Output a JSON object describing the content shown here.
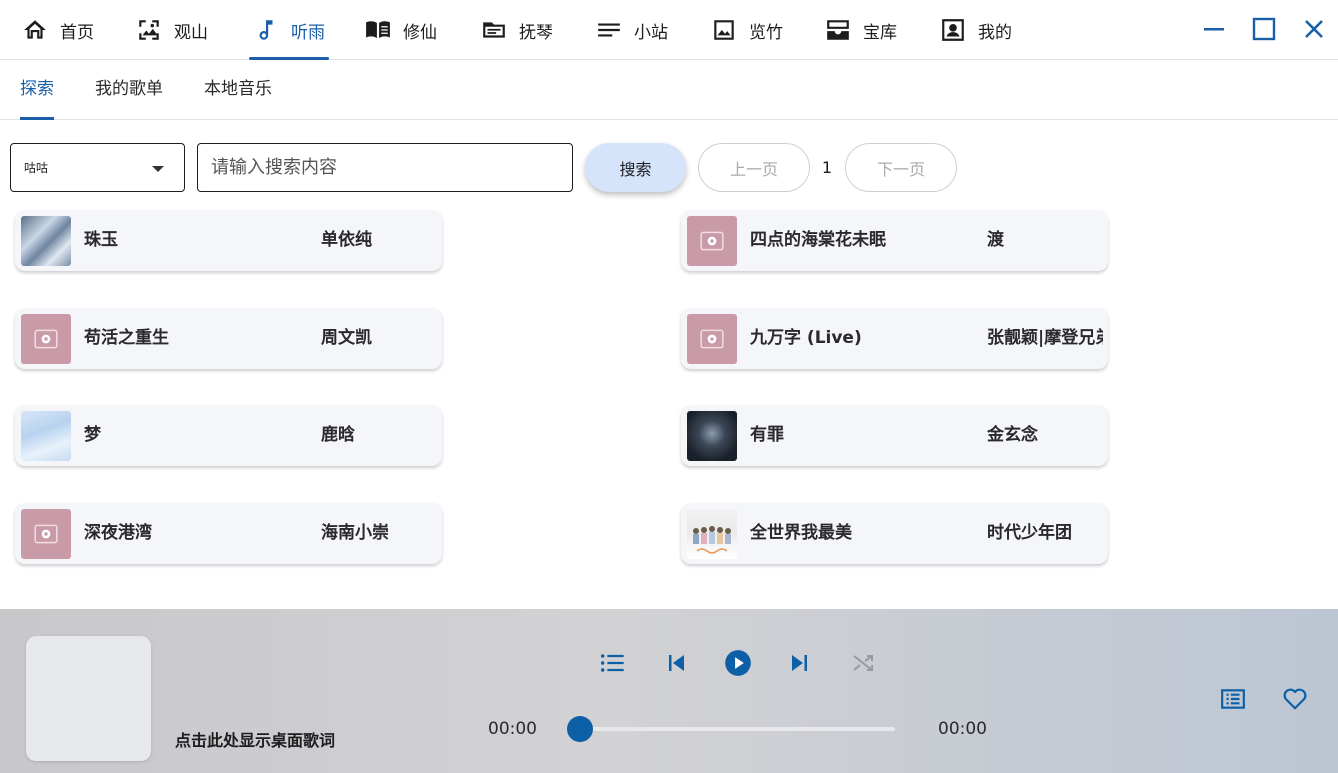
{
  "nav": {
    "items": [
      {
        "label": "首页",
        "icon": "home-icon"
      },
      {
        "label": "观山",
        "icon": "image-frame-icon"
      },
      {
        "label": "听雨",
        "icon": "music-note-icon"
      },
      {
        "label": "修仙",
        "icon": "book-open-icon"
      },
      {
        "label": "抚琴",
        "icon": "folder-icon"
      },
      {
        "label": "小站",
        "icon": "lines-icon"
      },
      {
        "label": "览竹",
        "icon": "photo-icon"
      },
      {
        "label": "宝库",
        "icon": "inbox-tray-icon"
      },
      {
        "label": "我的",
        "icon": "account-box-icon"
      }
    ],
    "active_index": 2
  },
  "subtabs": {
    "items": [
      {
        "label": "探索"
      },
      {
        "label": "我的歌单"
      },
      {
        "label": "本地音乐"
      }
    ],
    "active_index": 0
  },
  "search": {
    "source_value": "咕咕",
    "placeholder": "请输入搜索内容",
    "search_label": "搜索",
    "prev_label": "上一页",
    "page_number": "1",
    "next_label": "下一页"
  },
  "songs": [
    {
      "title": "珠玉",
      "artist": "单依纯",
      "cover": "ice"
    },
    {
      "title": "四点的海棠花未眠",
      "artist": "渡",
      "cover": "default"
    },
    {
      "title": "苟活之重生",
      "artist": "周文凯",
      "cover": "default"
    },
    {
      "title": "九万字 (Live)",
      "artist": "张靓颖|摩登兄弟",
      "cover": "default"
    },
    {
      "title": "梦",
      "artist": "鹿晗",
      "cover": "light"
    },
    {
      "title": "有罪",
      "artist": "金玄念",
      "cover": "dark"
    },
    {
      "title": "深夜港湾",
      "artist": "海南小崇",
      "cover": "default"
    },
    {
      "title": "全世界我最美",
      "artist": "时代少年团",
      "cover": "group"
    }
  ],
  "player": {
    "lyric_label": "点击此处显示桌面歌词",
    "current_time": "00:00",
    "total_time": "00:00",
    "progress": 0,
    "accent_color": "#0d5fa6"
  }
}
